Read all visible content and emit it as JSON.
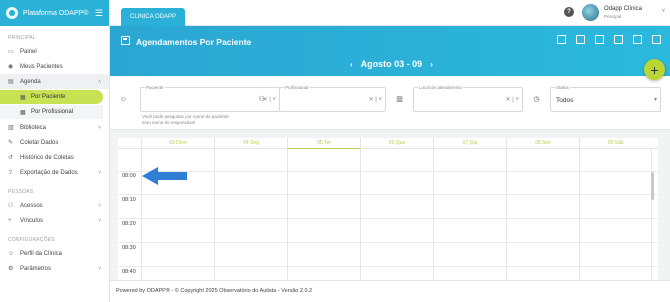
{
  "sidebar": {
    "brand": "Plataforma ODAPP®",
    "section_principal": "PRINCIPAL",
    "section_pessoas": "PESSOAS",
    "section_config": "CONFIGURAÇÕES",
    "items": {
      "painel": "Painel",
      "meus_pacientes": "Meus Pacientes",
      "agenda": "Agenda",
      "por_paciente": "Por Paciente",
      "por_profissional": "Por Profissional",
      "biblioteca": "Biblioteca",
      "coletar_dados": "Coletar Dados",
      "historico": "Histórico de Coletas",
      "exportacao": "Exportação de Dados",
      "acessos": "Acessos",
      "vinculos": "Vínculos",
      "perfil": "Perfil da Clínica",
      "parametros": "Parâmetros"
    }
  },
  "topbar": {
    "tab": "CLINICA ODAPP",
    "help": "?",
    "user_name": "Odapp Clínica",
    "user_role": "Principal"
  },
  "header": {
    "title": "Agendamentos Por Paciente",
    "range": "Agosto 03 - 09",
    "prev": "‹",
    "next": "›",
    "add": "+"
  },
  "filters": {
    "paciente_label": "Paciente",
    "profissional_label": "Profissional",
    "local_label": "Local de atendimento",
    "status_label": "Status",
    "status_value": "Todos",
    "hint_line1": "Você pode pesquisar por nome do paciente",
    "hint_line2": "e/ou nome do responsável"
  },
  "calendar": {
    "days": [
      "03 Dom",
      "04 Seg",
      "05 Ter",
      "06 Qua",
      "07 Qui",
      "08 Sex",
      "09 Sáb"
    ],
    "times": [
      "08:00",
      "08:10",
      "08:20",
      "08:30",
      "08:40"
    ]
  },
  "footer": {
    "text": "Powered by ODAPP® - © Copyright 2025 Observatório do Autista - Versão 2.0.2"
  },
  "colors": {
    "primary": "#2bb1d8",
    "accent": "#c8e254",
    "pointer": "#2f7fd6"
  }
}
